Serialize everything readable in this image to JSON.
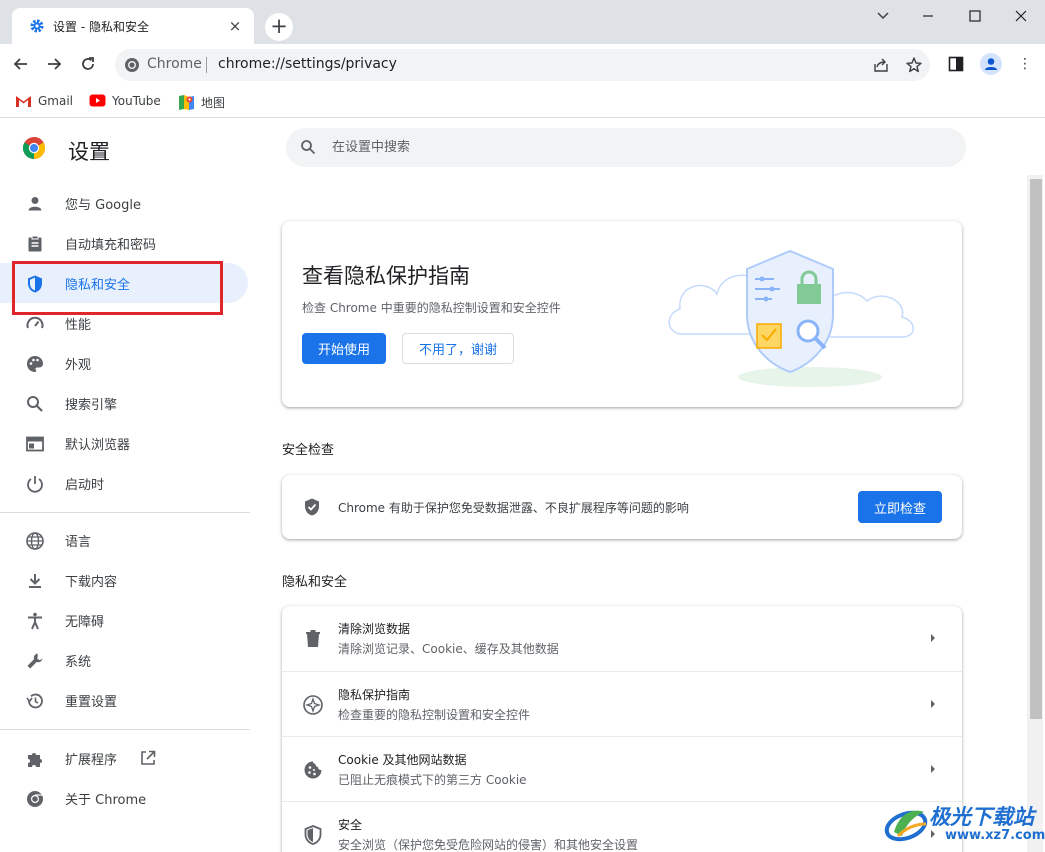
{
  "browser": {
    "tab_title": "设置 - 隐私和安全",
    "tab_close": "×",
    "new_tab": "+",
    "window_controls": {
      "minimize": "—",
      "maximize": "☐",
      "close": "✕",
      "tab_search": "⌄"
    },
    "omnibox": {
      "site_label": "Chrome",
      "url": "chrome://settings/privacy"
    },
    "menu": "⋮",
    "bookmarks": [
      "Gmail",
      "YouTube",
      "地图"
    ]
  },
  "settings": {
    "title": "设置",
    "search_placeholder": "在设置中搜索"
  },
  "sidebar": {
    "items": [
      {
        "label": "您与 Google",
        "icon": "person-icon"
      },
      {
        "label": "自动填充和密码",
        "icon": "clipboard-icon"
      },
      {
        "label": "隐私和安全",
        "icon": "shield-icon",
        "active": true
      },
      {
        "label": "性能",
        "icon": "speedometer-icon"
      },
      {
        "label": "外观",
        "icon": "palette-icon"
      },
      {
        "label": "搜索引擎",
        "icon": "search-icon"
      },
      {
        "label": "默认浏览器",
        "icon": "browser-icon"
      },
      {
        "label": "启动时",
        "icon": "power-icon"
      },
      {
        "label": "语言",
        "icon": "globe-icon"
      },
      {
        "label": "下载内容",
        "icon": "download-icon"
      },
      {
        "label": "无障碍",
        "icon": "accessibility-icon"
      },
      {
        "label": "系统",
        "icon": "wrench-icon"
      },
      {
        "label": "重置设置",
        "icon": "history-icon"
      },
      {
        "label": "扩展程序",
        "icon": "puzzle-icon"
      },
      {
        "label": "关于 Chrome",
        "icon": "chrome-icon"
      }
    ]
  },
  "guide": {
    "title": "查看隐私保护指南",
    "description": "检查 Chrome 中重要的隐私控制设置和安全控件",
    "start_label": "开始使用",
    "dismiss_label": "不用了，谢谢"
  },
  "safety_check": {
    "section_title": "安全检查",
    "text": "Chrome 有助于保护您免受数据泄露、不良扩展程序等问题的影响",
    "button_label": "立即检查"
  },
  "privacy": {
    "section_title": "隐私和安全",
    "rows": [
      {
        "title": "清除浏览数据",
        "subtitle": "清除浏览记录、Cookie、缓存及其他数据",
        "icon": "trash-icon"
      },
      {
        "title": "隐私保护指南",
        "subtitle": "检查重要的隐私控制设置和安全控件",
        "icon": "compass-icon"
      },
      {
        "title": "Cookie 及其他网站数据",
        "subtitle": "已阻止无痕模式下的第三方 Cookie",
        "icon": "cookie-icon"
      },
      {
        "title": "安全",
        "subtitle": "安全浏览（保护您免受危险网站的侵害）和其他安全设置",
        "icon": "security-shield-icon"
      }
    ]
  },
  "watermark": {
    "name": "极光下载站",
    "url": "www.xz7.com"
  },
  "colors": {
    "accent": "#1a73e8",
    "active_bg": "#e8f0fe",
    "highlight_box": "#e0252b"
  }
}
